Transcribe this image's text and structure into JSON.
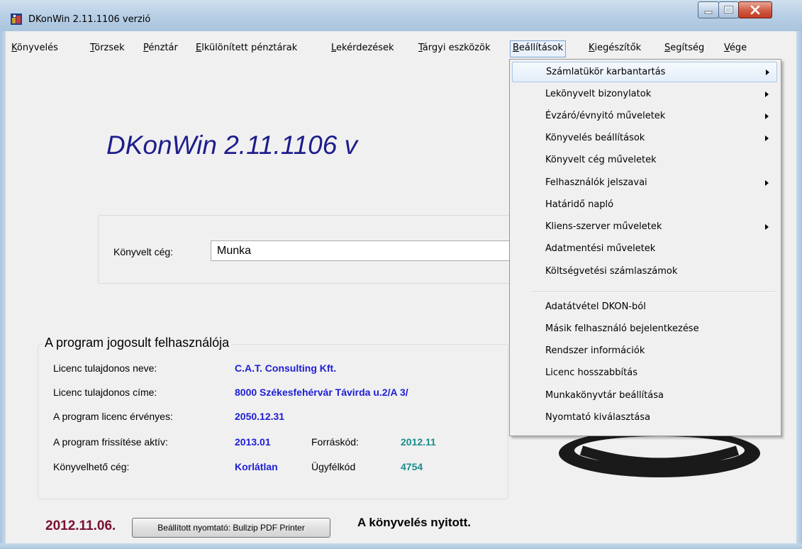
{
  "window": {
    "title": "DKonWin 2.11.1106 verzió"
  },
  "menubar": [
    {
      "label": "Könyvelés"
    },
    {
      "label": "Törzsek"
    },
    {
      "label": "Pénztár"
    },
    {
      "label": "Elkülönített pénztárak"
    },
    {
      "label": "Lekérdezések"
    },
    {
      "label": "Tárgyi eszközök"
    },
    {
      "label": "Beállítások"
    },
    {
      "label": "Kiegészítők"
    },
    {
      "label": "Segítség"
    },
    {
      "label": "Vége"
    }
  ],
  "main": {
    "big_title": "DKonWin 2.11.1106 v",
    "company_label": "Könyvelt cég:",
    "company_value": "Munka"
  },
  "license": {
    "legend": "A program jogosult felhasználója",
    "rows": [
      {
        "label": "Licenc tulajdonos neve:",
        "value": "C.A.T. Consulting Kft."
      },
      {
        "label": "Licenc tulajdonos címe:",
        "value": "8000 Székesfehérvár Távirda u.2/A 3/"
      },
      {
        "label": "A program licenc érvényes:",
        "value": "2050.12.31"
      },
      {
        "label": "A program frissítése aktív:",
        "value": "2013.01",
        "label2": "Forráskód:",
        "value2": "2012.11"
      },
      {
        "label": "Könyvelhető cég:",
        "value": "Korlátlan",
        "label2": "Ügyfélkód",
        "value2": "4754"
      }
    ]
  },
  "footer": {
    "date": "2012.11.06.",
    "printer_button": "Beállított nyomtató: Bullzip PDF Printer",
    "status": "A könyvelés nyitott."
  },
  "dropdown": {
    "items": [
      {
        "label": "Számlatükör karbantartás",
        "submenu": true,
        "highlighted": true
      },
      {
        "label": "Lekönyvelt bizonylatok",
        "submenu": true
      },
      {
        "label": "Évzáró/évnyitó műveletek",
        "submenu": true
      },
      {
        "label": "Könyvelés beállítások",
        "submenu": true
      },
      {
        "label": "Könyvelt cég műveletek",
        "submenu": false
      },
      {
        "label": "Felhasználók jelszavai",
        "submenu": true
      },
      {
        "label": "Határidő napló",
        "submenu": false
      },
      {
        "label": "Kliens-szerver műveletek",
        "submenu": true
      },
      {
        "label": "Adatmentési műveletek",
        "submenu": false
      },
      {
        "label": "Költségvetési számlaszámok",
        "submenu": false
      },
      {
        "label": "Adatátvétel DKON-ból",
        "submenu": false
      },
      {
        "label": "Másik felhasználó bejelentkezése",
        "submenu": false
      },
      {
        "label": "Rendszer információk",
        "submenu": false
      },
      {
        "label": "Licenc hosszabbítás",
        "submenu": false
      },
      {
        "label": "Munkakönyvtár beállítása",
        "submenu": false
      },
      {
        "label": "Nyomtató kiválasztása",
        "submenu": false
      }
    ]
  },
  "colors": {
    "title_blue": "#1d1d8c",
    "value_blue": "#1d1dd6",
    "value_teal": "#1b8c8c",
    "date_color": "#7a1030"
  }
}
